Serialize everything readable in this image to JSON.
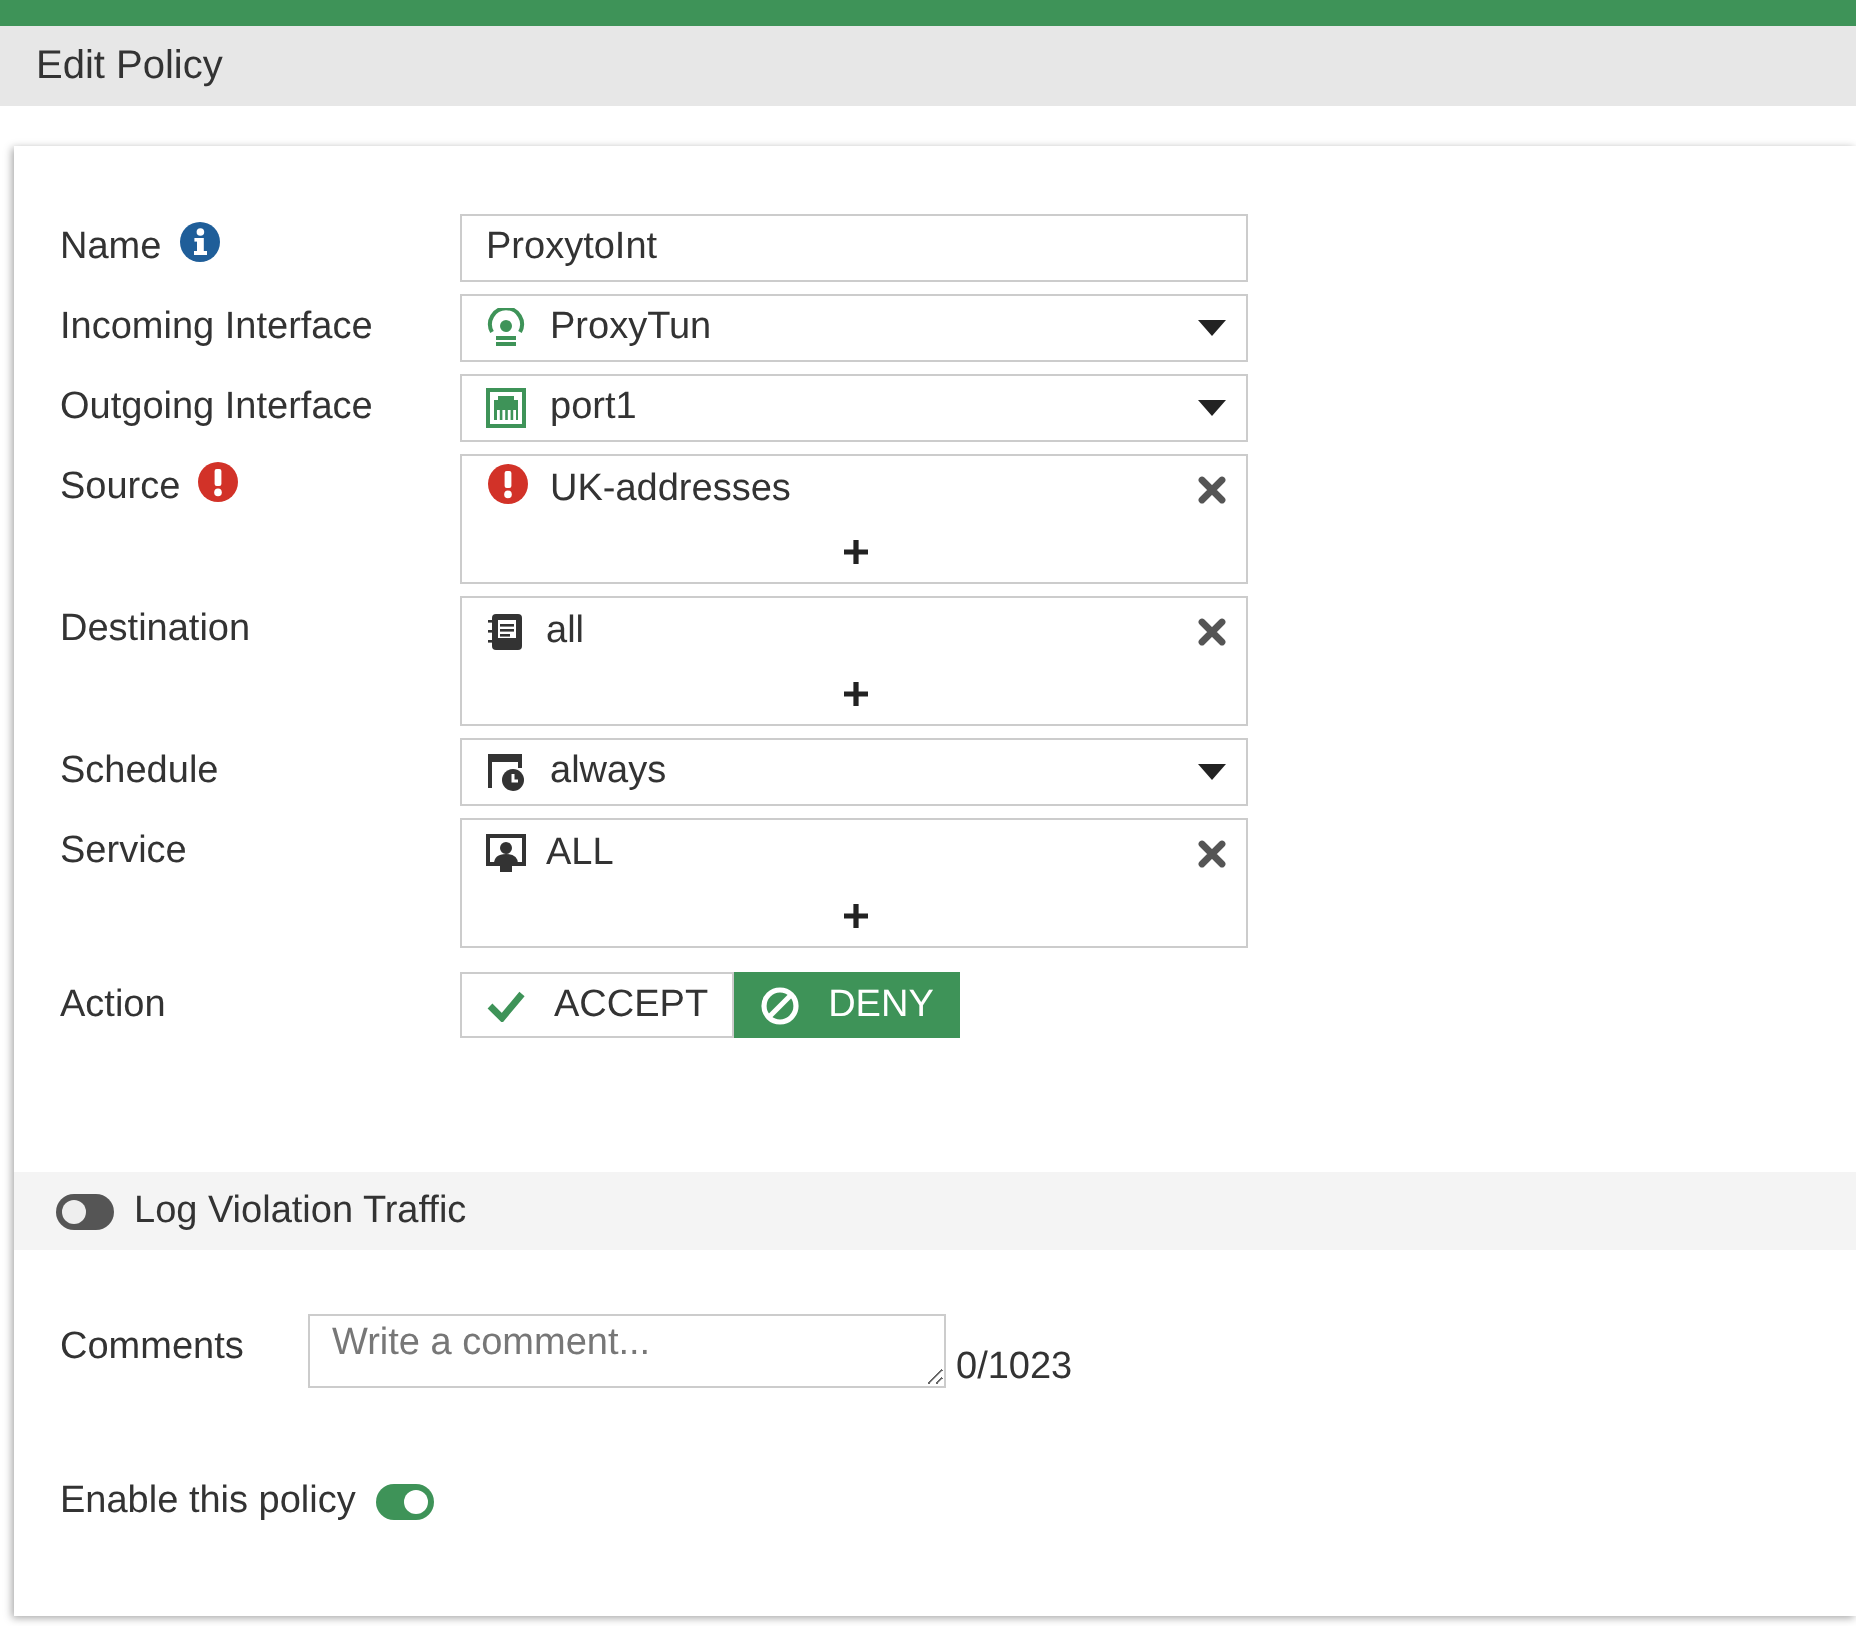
{
  "header": {
    "title": "Edit Policy"
  },
  "fields": [
    {
      "label": "Name",
      "kind": "text",
      "hint": true,
      "value": "ProxytoInt"
    },
    {
      "label": "Incoming Interface",
      "kind": "select",
      "value": "ProxyTun"
    },
    {
      "label": "Outgoing Interface",
      "kind": "select",
      "value": "port1"
    },
    {
      "label": "Source",
      "kind": "multi",
      "invalid": true,
      "items": [
        {
          "text": "UK-addresses",
          "invalid": true
        }
      ]
    },
    {
      "label": "Destination",
      "kind": "multi",
      "items": [
        {
          "text": "all"
        }
      ]
    },
    {
      "label": "Schedule",
      "kind": "select",
      "value": "always"
    },
    {
      "label": "Service",
      "kind": "multi",
      "items": [
        {
          "text": "ALL"
        }
      ]
    },
    {
      "label": "Action",
      "kind": "action",
      "options": [
        {
          "label": "ACCEPT",
          "selected": false
        },
        {
          "label": "DENY",
          "selected": true
        }
      ]
    }
  ],
  "log_violation_traffic": {
    "label": "Log Violation Traffic",
    "on": false
  },
  "comments": {
    "label": "Comments",
    "placeholder": "Write a comment...",
    "counter": "0/1023"
  },
  "enable_policy": {
    "label": "Enable this policy",
    "on": true
  }
}
